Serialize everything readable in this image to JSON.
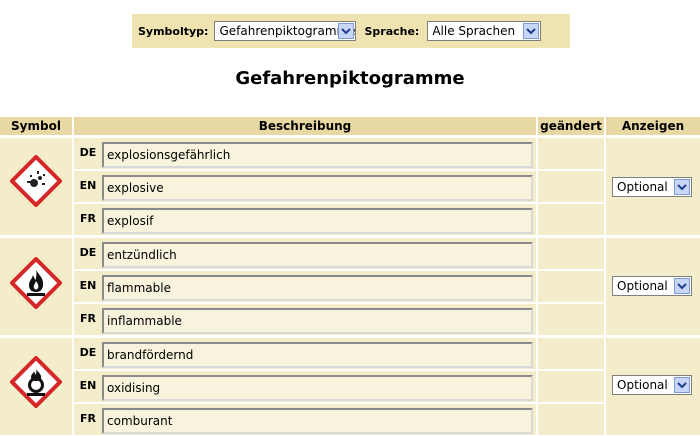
{
  "filter_bar": {
    "symboltyp_label": "Symboltyp:",
    "symboltyp_value": "Gefahrenpiktogramme",
    "sprache_label": "Sprache:",
    "sprache_value": "Alle Sprachen"
  },
  "title": "Gefahrenpiktogramme",
  "table": {
    "headers": {
      "symbol": "Symbol",
      "beschreibung": "Beschreibung",
      "geaendert": "geändert",
      "anzeigen": "Anzeigen"
    },
    "rows": [
      {
        "icon": "explosive-pictogram-icon",
        "descriptions": [
          {
            "lang": "DE",
            "text": "explosionsgefährlich"
          },
          {
            "lang": "EN",
            "text": "explosive"
          },
          {
            "lang": "FR",
            "text": "explosif"
          }
        ],
        "anzeigen": "Optional"
      },
      {
        "icon": "flame-pictogram-icon",
        "descriptions": [
          {
            "lang": "DE",
            "text": "entzündlich"
          },
          {
            "lang": "EN",
            "text": "flammable"
          },
          {
            "lang": "FR",
            "text": "inflammable"
          }
        ],
        "anzeigen": "Optional"
      },
      {
        "icon": "flame-over-circle-pictogram-icon",
        "descriptions": [
          {
            "lang": "DE",
            "text": "brandfördernd"
          },
          {
            "lang": "EN",
            "text": "oxidising"
          },
          {
            "lang": "FR",
            "text": "comburant"
          }
        ],
        "anzeigen": "Optional"
      }
    ]
  },
  "colors": {
    "header_bg": "#e7d8a4",
    "cell_bg": "#f4edcc",
    "pictogram_border": "#d62728"
  }
}
